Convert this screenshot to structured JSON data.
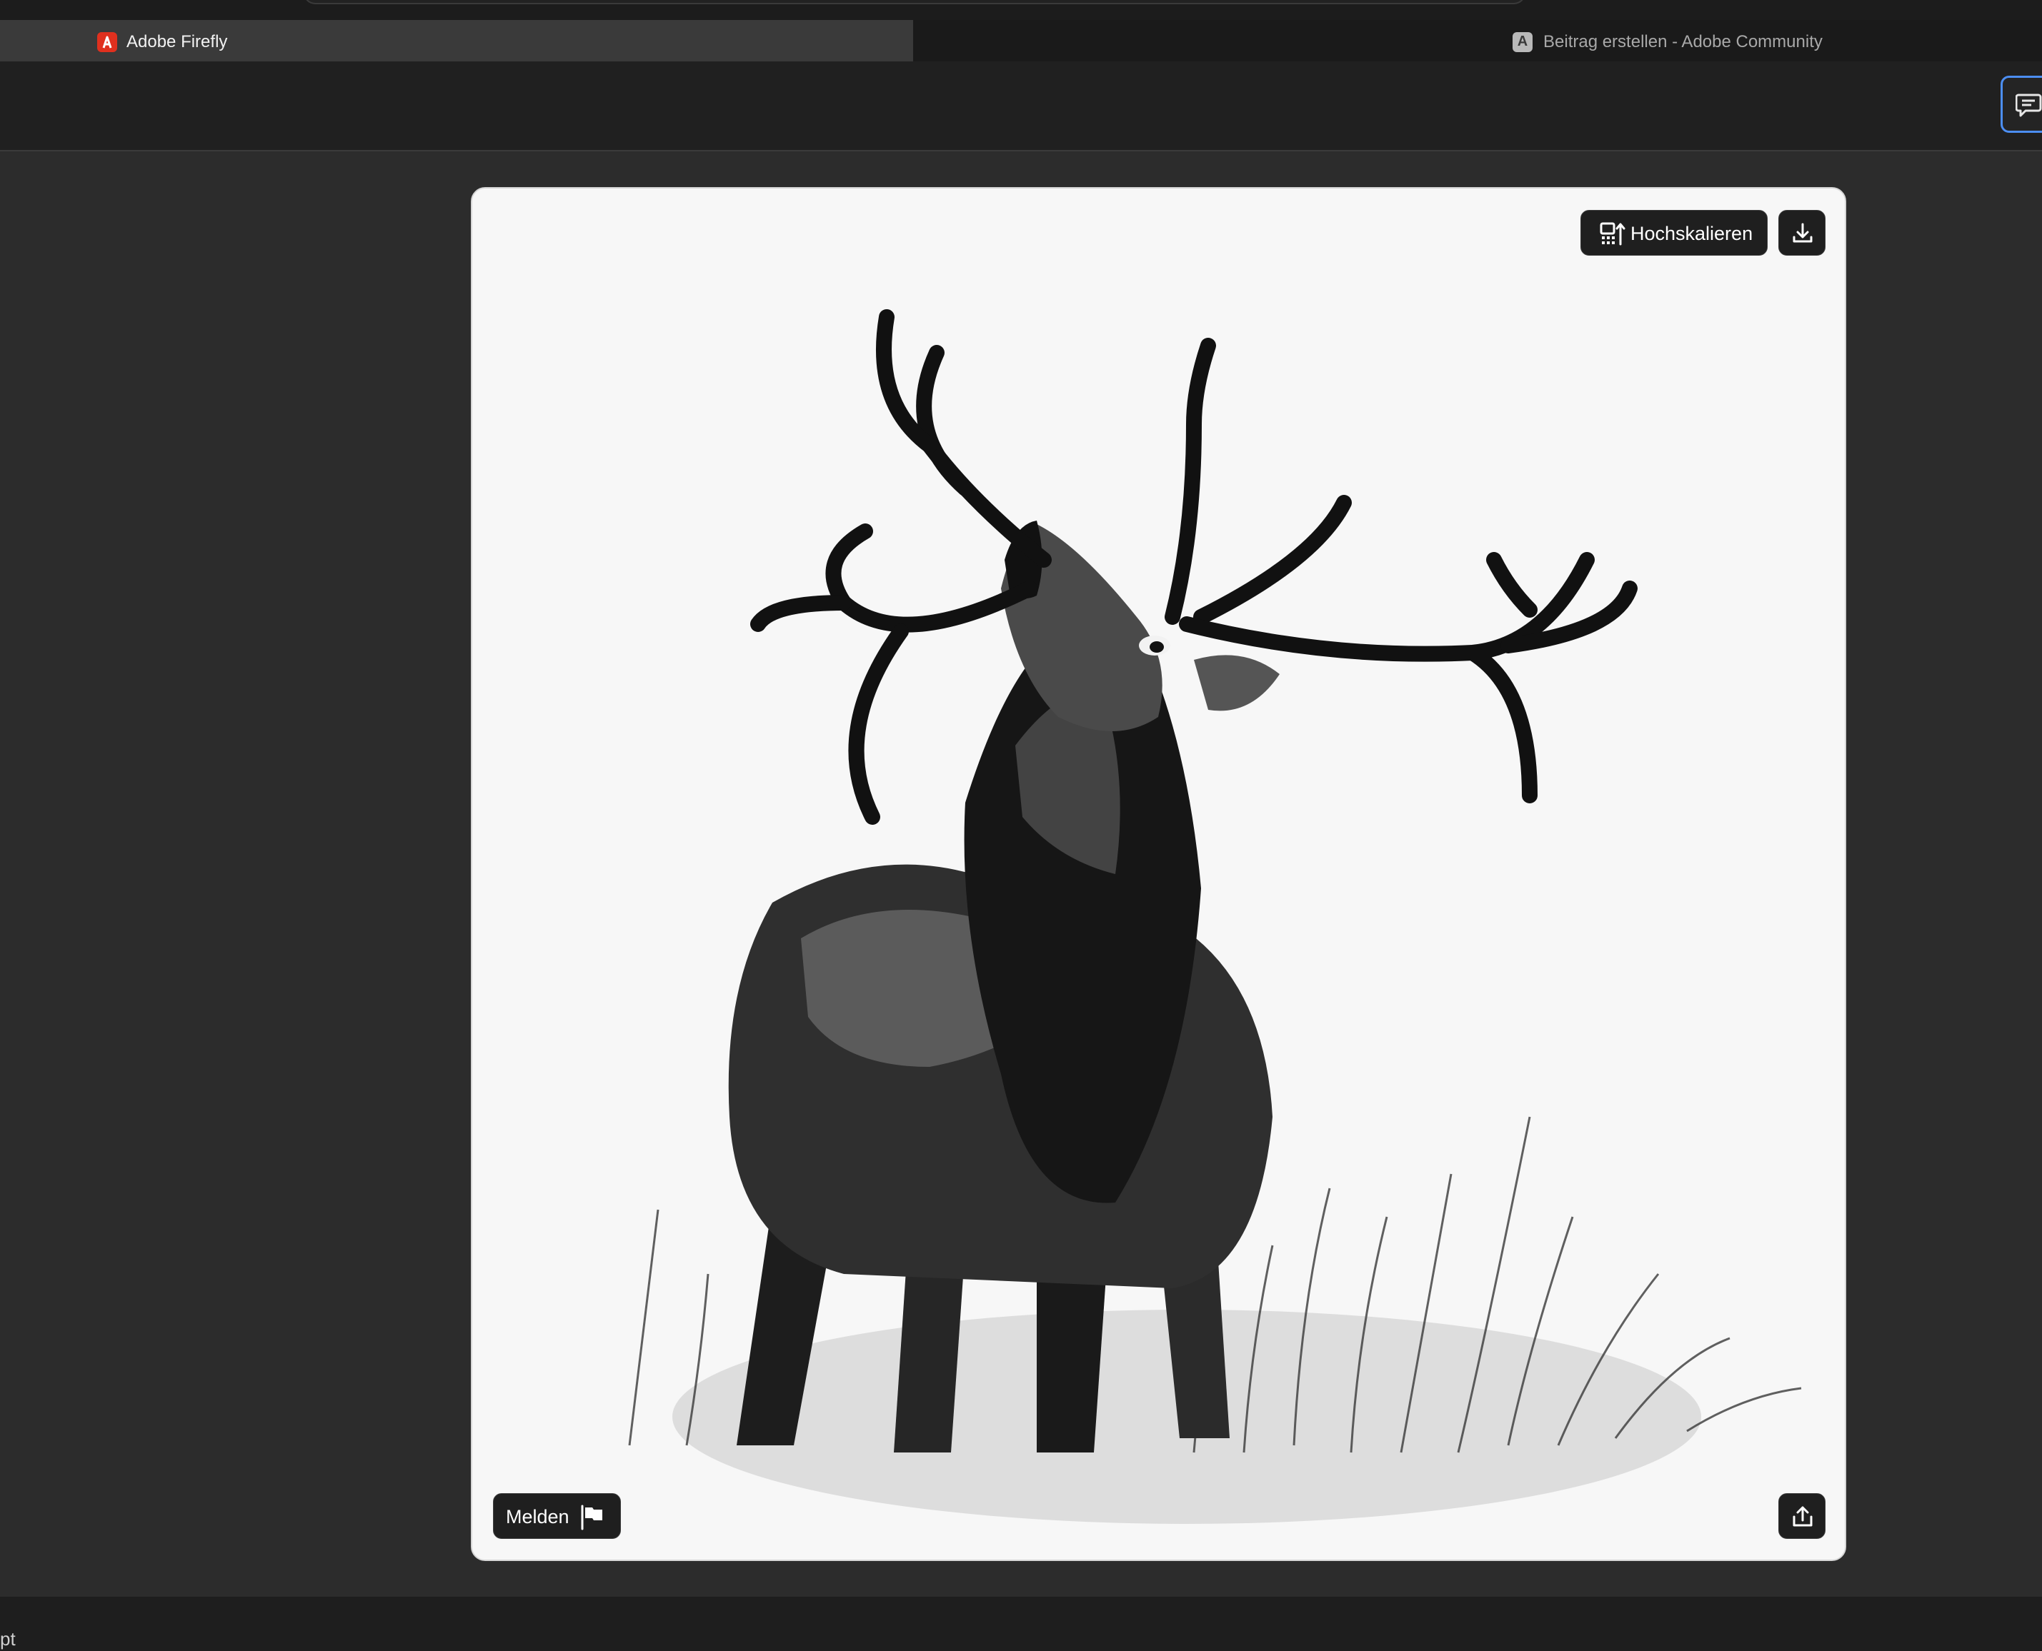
{
  "browser": {
    "tabs": [
      {
        "label": "Adobe Firefly",
        "icon": "adobe-firefly-icon",
        "active": true
      },
      {
        "label": "Beitrag erstellen - Adobe Community",
        "icon": "adobe-community-icon",
        "active": false
      }
    ],
    "tab2_icon_letter": "A"
  },
  "header": {
    "feedback_icon": "chat-feedback-icon",
    "accent_color": "#4c8ef2"
  },
  "image_card": {
    "upscale_label": "Hochskalieren",
    "upscale_icon": "upscale-icon",
    "download_icon": "download-icon",
    "report_label": "Melden",
    "report_icon": "flag-icon",
    "share_icon": "share-icon",
    "artwork": "black-and-white ink illustration of a roaring red deer stag in tall grass"
  },
  "footer": {
    "partial_text": "pt"
  }
}
